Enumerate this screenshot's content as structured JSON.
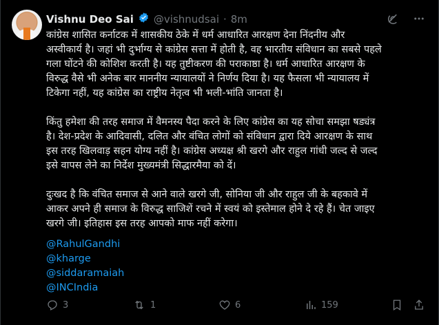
{
  "author": {
    "name": "Vishnu Deo Sai",
    "handle": "@vishnudsai",
    "separator": "·",
    "time": "8m"
  },
  "tweet": {
    "paragraph_1": "कांग्रेस शासित कर्नाटक में शासकीय ठेके में धर्म आधारित आरक्षण देना निंदनीय और\nअस्वीकार्य है। जहां भी दुर्भाग्य से कांग्रेस सत्ता में होती है, वह भारतीय संविधान का सबसे पहले\nगला घोंटने की कोशिश करती है। यह तुष्टीकरण की पराकाष्ठा है। धर्म आधारित आरक्षण के\nविरुद्ध वैसे भी अनेक बार माननीय न्यायालयों ने निर्णय दिया है। यह फैसला भी न्यायालय में\nटिकेगा नहीं, यह कांग्रेस का राष्ट्रीय नेतृत्व भी भली-भांति जानता है।",
    "paragraph_2": "किंतु हमेशा की तरह समाज में वैमनस्य पैदा करने के लिए कांग्रेस का यह सोचा समझा षड्यंत्र\nहै। देश-प्रदेश के आदिवासी, दलित और वंचित लोगों को संविधान द्वारा दिये आरक्षण के साथ\nइस तरह खिलवाड़ सहन योग्य नहीं है। कांग्रेस अध्यक्ष श्री खरगे और राहुल गांधी जल्द से जल्द\nइसे वापस लेने का निर्देश मुख्यमंत्री सिद्धारमैया को दें।",
    "paragraph_3": "दुःखद है कि वंचित समाज से आने वाले खरगे जी, सोनिया जी और राहुल जी के बहकावे में\nआकर अपने ही समाज के विरुद्ध साजिशें रचने में स्वयं को इस्तेमाल होने दे रहे हैं। चेत जाइए\nखरगे जी। इतिहास इस तरह आपको माफ नहीं करेगा।",
    "mentions": [
      "@RahulGandhi",
      "@kharge",
      "@siddaramaiah",
      "@INCIndia"
    ]
  },
  "actions": {
    "replies": "3",
    "reposts": "1",
    "likes": "6",
    "views": "159"
  },
  "colors": {
    "background": "#000000",
    "text": "#e7e9ea",
    "muted": "#71767b",
    "link": "#1d9bf0"
  },
  "icons": [
    "grok-icon",
    "more-icon",
    "reply-icon",
    "repost-icon",
    "like-icon",
    "views-icon",
    "bookmark-icon",
    "share-icon"
  ]
}
